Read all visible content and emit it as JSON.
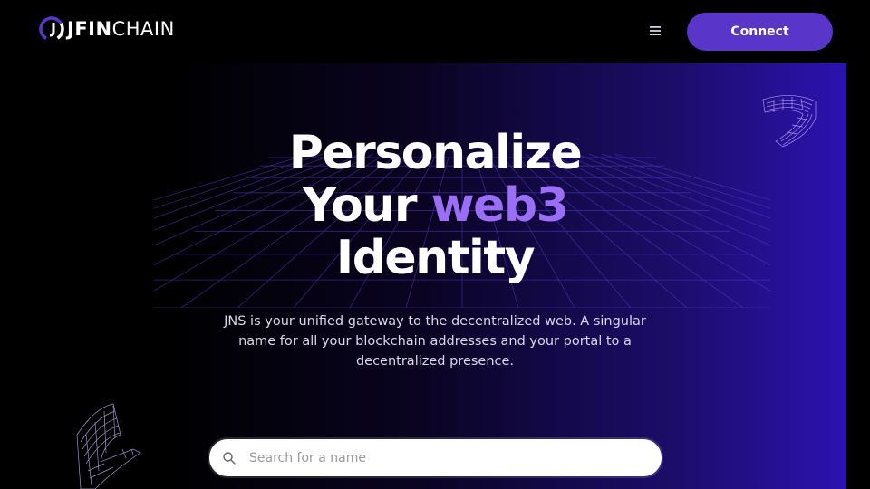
{
  "header": {
    "logo_text_bold": "JFIN",
    "logo_text_light": "CHAIN",
    "menu_icon": "hamburger-menu-icon",
    "connect_label": "Connect"
  },
  "hero": {
    "title_line1": "Personalize",
    "title_line2_plain": "Your",
    "title_line2_accent": "web3",
    "title_line3": "Identity",
    "description": "JNS is your unified gateway to the decentralized web. A singular name for all your blockchain addresses and your portal to a decentralized presence."
  },
  "search": {
    "placeholder": "Search for a name",
    "icon": "search-icon"
  },
  "colors": {
    "accent": "#9b6ff5",
    "button": "#5a35c9",
    "gradient_end": "#2c12b0"
  }
}
